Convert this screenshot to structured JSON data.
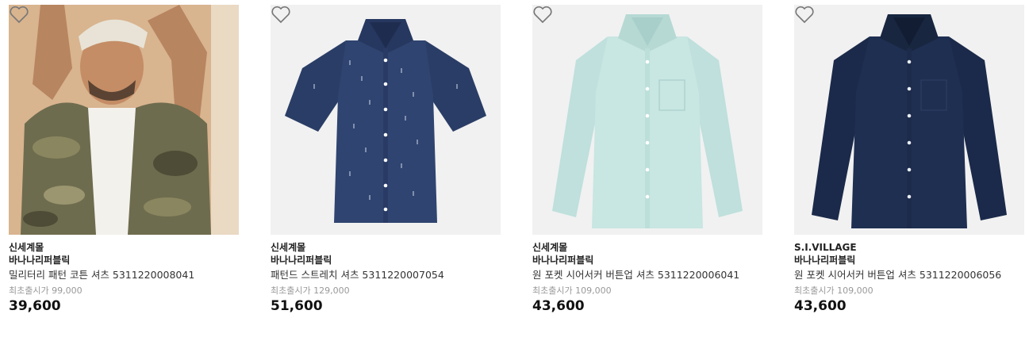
{
  "products": [
    {
      "seller": "신세계몰",
      "brand": "바나나리퍼블릭",
      "name": "밀리터리 패턴 코튼 셔츠 5311220008041",
      "original_price": "최초출시가 99,000",
      "price": "39,600",
      "wishlist_icon": "heart-outline-icon"
    },
    {
      "seller": "신세계몰",
      "brand": "바나나리퍼블릭",
      "name": "패턴드 스트레치 셔츠 5311220007054",
      "original_price": "최초출시가 129,000",
      "price": "51,600",
      "wishlist_icon": "heart-outline-icon"
    },
    {
      "seller": "신세계몰",
      "brand": "바나나리퍼블릭",
      "name": "원 포켓 시어서커 버튼업 셔츠 5311220006041",
      "original_price": "최초출시가 109,000",
      "price": "43,600",
      "wishlist_icon": "heart-outline-icon"
    },
    {
      "seller": "S.I.VILLAGE",
      "brand": "바나나리퍼블릭",
      "name": "원 포켓 시어서커 버튼업 셔츠 5311220006056",
      "original_price": "최초출시가 109,000",
      "price": "43,600",
      "wishlist_icon": "heart-outline-icon"
    }
  ],
  "colors": {
    "camo_shirt": "#6b6a4c",
    "navy_short_sleeve": "#2a3d66",
    "mint_shirt": "#c5e4e0",
    "navy_long_sleeve": "#1b2a4a",
    "price_text": "#111111",
    "muted_text": "#999999"
  }
}
